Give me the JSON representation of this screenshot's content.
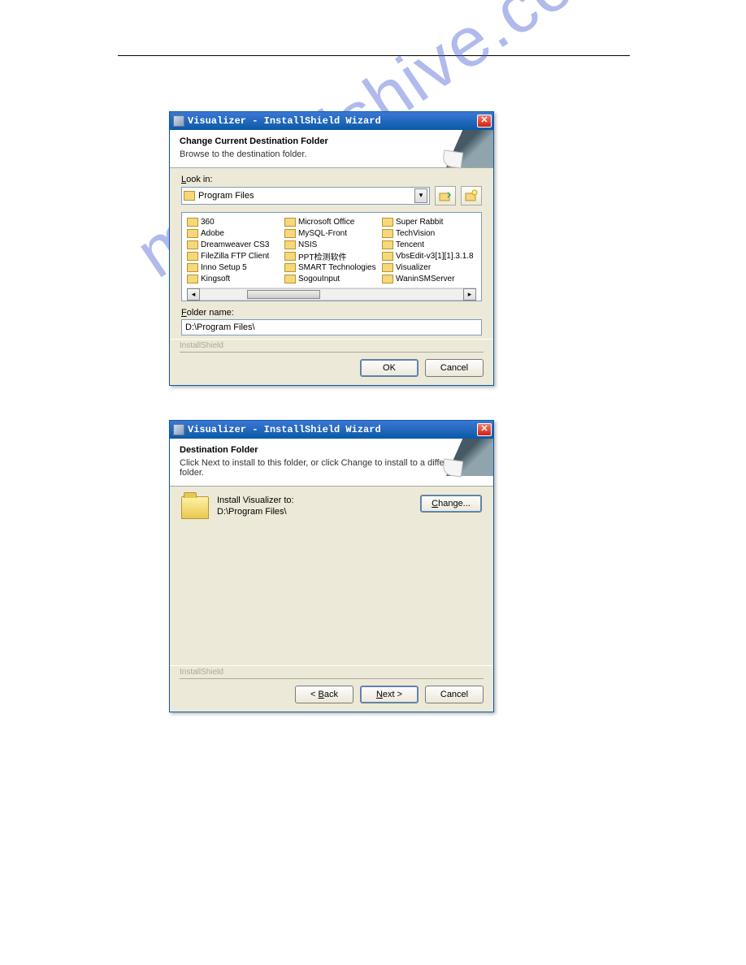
{
  "watermark": "manualshive.com",
  "dialog1": {
    "title": "Visualizer - InstallShield Wizard",
    "header_title": "Change Current Destination Folder",
    "header_sub": "Browse to the destination folder.",
    "lookin_label_pre": "L",
    "lookin_label_post": "ook in:",
    "combo_value": "Program Files",
    "folder_name_label_pre": "F",
    "folder_name_label_post": "older name:",
    "folder_name_value": "D:\\Program Files\\",
    "brand": "InstallShield",
    "ok": "OK",
    "cancel": "Cancel",
    "folders_col1": [
      "360",
      "Adobe",
      "Dreamweaver CS3",
      "FileZilla FTP Client",
      "Inno Setup 5",
      "Kingsoft"
    ],
    "folders_col2": [
      "Microsoft Office",
      "MySQL-Front",
      "NSIS",
      "PPT检测软件",
      "SMART Technologies",
      "SogouInput"
    ],
    "folders_col3": [
      "Super Rabbit",
      "TechVision",
      "Tencent",
      "VbsEdit-v3[1][1].3.1.8",
      "Visualizer",
      "WaninSMServer"
    ]
  },
  "dialog2": {
    "title": "Visualizer - InstallShield Wizard",
    "header_title": "Destination Folder",
    "header_sub": "Click Next to install to this folder, or click Change to install to a different folder.",
    "install_to": "Install Visualizer to:",
    "install_path": "D:\\Program Files\\",
    "change_pre": "C",
    "change_post": "hange...",
    "brand": "InstallShield",
    "back_pre": "< ",
    "back_u": "B",
    "back_post": "ack",
    "next_u": "N",
    "next_post": "ext >",
    "cancel": "Cancel"
  }
}
